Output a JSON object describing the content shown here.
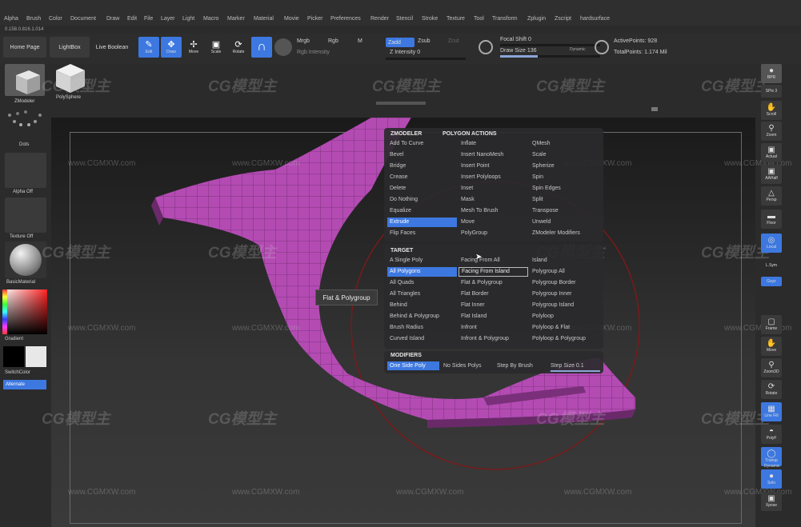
{
  "menu": [
    "Alpha",
    "Brush",
    "Color",
    "Document",
    "Draw",
    "Edit",
    "File",
    "Layer",
    "Light",
    "Macro",
    "Marker",
    "Material",
    "Movie",
    "Picker",
    "Preferences",
    "Render",
    "Stencil",
    "Stroke",
    "Texture",
    "Tool",
    "Transform",
    "Zplugin",
    "Zscript",
    "hardsurface"
  ],
  "version": "0.158.0.816.1.014",
  "shelf": {
    "home_page": "Home Page",
    "lightbox": "LightBox",
    "live_boolean": "Live Boolean",
    "tools": [
      "Edit",
      "Draw",
      "Move",
      "Scale",
      "Rotate"
    ],
    "mrgb": "Mrgb",
    "rgb": "Rgb",
    "m": "M",
    "zadd": "Zadd",
    "zsub": "Zsub",
    "zcut": "Zcut",
    "rgb_intensity": "Rgb Intensity",
    "z_intensity": "Z Intensity 0",
    "focal_shift": "Focal Shift 0",
    "draw_size": "Draw Size 136",
    "dynamic": "Dynamic",
    "active_points": "ActivePoints: 928",
    "total_points": "TotalPoints: 1.174 Mil"
  },
  "left": {
    "zmodeler": "ZModeler",
    "polysphere": "PolySphere",
    "dots": "Dots",
    "alpha_off": "Alpha Off",
    "texture_off": "Texture Off",
    "basic_material": "BasicMaterial",
    "gradient": "Gradient",
    "switch_color": "SwitchColor",
    "alternate": "Alternate"
  },
  "right": [
    "BPR",
    "SPix 3",
    "Scroll",
    "Zoom",
    "Actual",
    "AAHalf",
    "Persp",
    "Floor",
    "Local",
    "L.Sym",
    "Gxyz",
    "Frame",
    "Move",
    "Zoom3D",
    "Rotate",
    "Line Fill",
    "PolyF",
    "Transp",
    "Dynamic",
    "Solo",
    "Xpose"
  ],
  "popup": {
    "zmodeler_header": "ZMODELER",
    "polygon_actions_header": "POLYGON ACTIONS",
    "actions_col1": [
      "Add To Curve",
      "Bevel",
      "Bridge",
      "Crease",
      "Delete",
      "Do Nothing",
      "Equalize",
      "Extrude",
      "Flip Faces"
    ],
    "actions_col2": [
      "Inflate",
      "Insert NanoMesh",
      "Insert Point",
      "Insert Polyloops",
      "Inset",
      "Mask",
      "Mesh To Brush",
      "Move",
      "PolyGroup"
    ],
    "actions_col3": [
      "QMesh",
      "Scale",
      "Spherize",
      "Spin",
      "Spin Edges",
      "Split",
      "Transpose",
      "Unweld",
      "ZModeler Modifiers"
    ],
    "selected_action": "Extrude",
    "target_header": "TARGET",
    "target_col1": [
      "A Single Poly",
      "All Polygons",
      "All Quads",
      "All Triangles",
      "Behind",
      "Behind & Polygroup",
      "Brush Radius",
      "Curved Island"
    ],
    "target_col2": [
      "Facing From All",
      "Facing From Island",
      "Flat & Polygroup",
      "Flat Border",
      "Flat Inner",
      "Flat Island",
      "Infront",
      "Infront & Polygroup"
    ],
    "target_col3": [
      "Island",
      "Polygroup All",
      "Polygroup Border",
      "Polygroup Inner",
      "Polygroup Island",
      "Polyloop",
      "Polyloop & Flat",
      "Polyloop & Polygroup"
    ],
    "selected_target": "All Polygons",
    "hovered_target": "Facing From Island",
    "modifiers_header": "MODIFIERS",
    "modifiers": [
      "One Side Poly",
      "No Sides Polys",
      "Step By Brush",
      "Step Size 0.1"
    ]
  },
  "tooltip": "Flat & Polygroup",
  "watermark": "CG模型主",
  "watermark_url": "www.CGMXW.com",
  "colors": {
    "accent": "#3d78e0",
    "mesh": "#b34bb3"
  }
}
